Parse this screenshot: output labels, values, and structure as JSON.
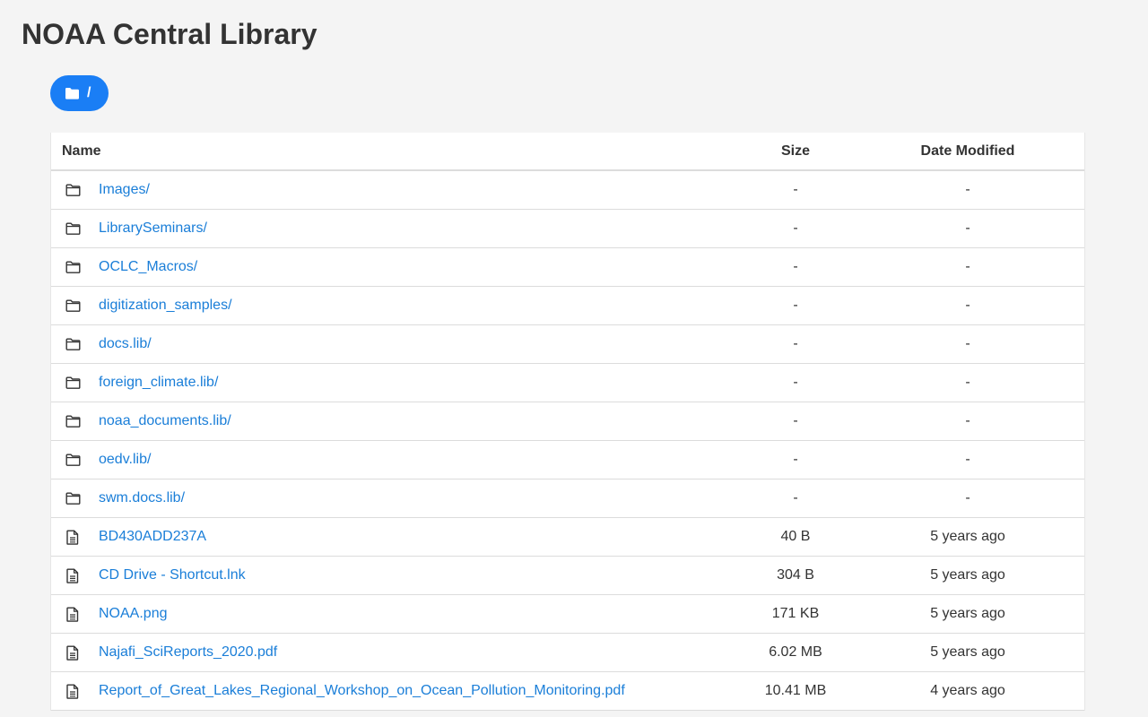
{
  "page": {
    "title": "NOAA Central Library"
  },
  "breadcrumb": {
    "label": "/"
  },
  "table": {
    "headers": {
      "name": "Name",
      "size": "Size",
      "date": "Date Modified"
    },
    "rows": [
      {
        "type": "folder",
        "name": "Images/",
        "size": "-",
        "date": "-"
      },
      {
        "type": "folder",
        "name": "LibrarySeminars/",
        "size": "-",
        "date": "-"
      },
      {
        "type": "folder",
        "name": "OCLC_Macros/",
        "size": "-",
        "date": "-"
      },
      {
        "type": "folder",
        "name": "digitization_samples/",
        "size": "-",
        "date": "-"
      },
      {
        "type": "folder",
        "name": "docs.lib/",
        "size": "-",
        "date": "-"
      },
      {
        "type": "folder",
        "name": "foreign_climate.lib/",
        "size": "-",
        "date": "-"
      },
      {
        "type": "folder",
        "name": "noaa_documents.lib/",
        "size": "-",
        "date": "-"
      },
      {
        "type": "folder",
        "name": "oedv.lib/",
        "size": "-",
        "date": "-"
      },
      {
        "type": "folder",
        "name": "swm.docs.lib/",
        "size": "-",
        "date": "-"
      },
      {
        "type": "file",
        "name": "BD430ADD237A",
        "size": "40 B",
        "date": "5 years ago"
      },
      {
        "type": "file",
        "name": "CD Drive - Shortcut.lnk",
        "size": "304 B",
        "date": "5 years ago"
      },
      {
        "type": "file",
        "name": "NOAA.png",
        "size": "171 KB",
        "date": "5 years ago"
      },
      {
        "type": "file",
        "name": "Najafi_SciReports_2020.pdf",
        "size": "6.02 MB",
        "date": "5 years ago"
      },
      {
        "type": "file",
        "name": "Report_of_Great_Lakes_Regional_Workshop_on_Ocean_Pollution_Monitoring.pdf",
        "size": "10.41 MB",
        "date": "4 years ago"
      }
    ]
  },
  "colors": {
    "accent": "#1a7ef5",
    "link": "#1a7ed8",
    "background": "#f4f4f4"
  },
  "icons": {
    "folder": "folder-icon",
    "file": "file-icon"
  }
}
